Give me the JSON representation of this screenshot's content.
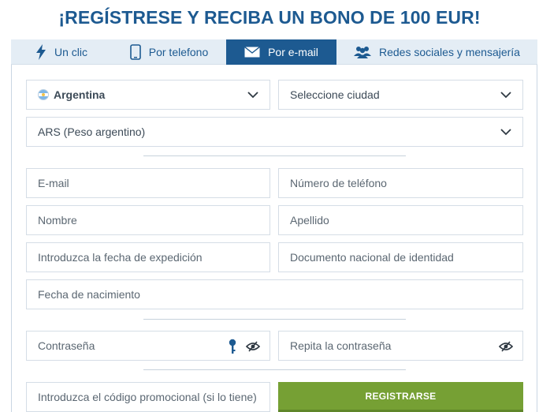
{
  "title": "¡REGÍSTRESE Y RECIBA UN BONO DE 100 EUR!",
  "tabs": [
    {
      "label": "Un clic",
      "icon": "lightning-icon"
    },
    {
      "label": "Por telefono",
      "icon": "phone-icon"
    },
    {
      "label": "Por e-mail",
      "icon": "envelope-icon",
      "active": true
    },
    {
      "label": "Redes sociales y mensajería",
      "icon": "users-icon"
    }
  ],
  "form": {
    "country": "Argentina",
    "city": "Seleccione ciudad",
    "currency": "ARS (Peso argentino)",
    "email": "E-mail",
    "phone": "Número de teléfono",
    "first_name": "Nombre",
    "last_name": "Apellido",
    "issue_date": "Introduzca la fecha de expedición",
    "national_id": "Documento nacional de identidad",
    "birth_date": "Fecha de nacimiento",
    "password": "Contraseña",
    "repeat_password": "Repita la contraseña",
    "promo_code": "Introduzca el código promocional (si lo tiene)",
    "submit": "REGISTRARSE"
  },
  "colors": {
    "brand": "#1d5a91",
    "tab_bg": "#e4edf5",
    "submit": "#76a034"
  }
}
